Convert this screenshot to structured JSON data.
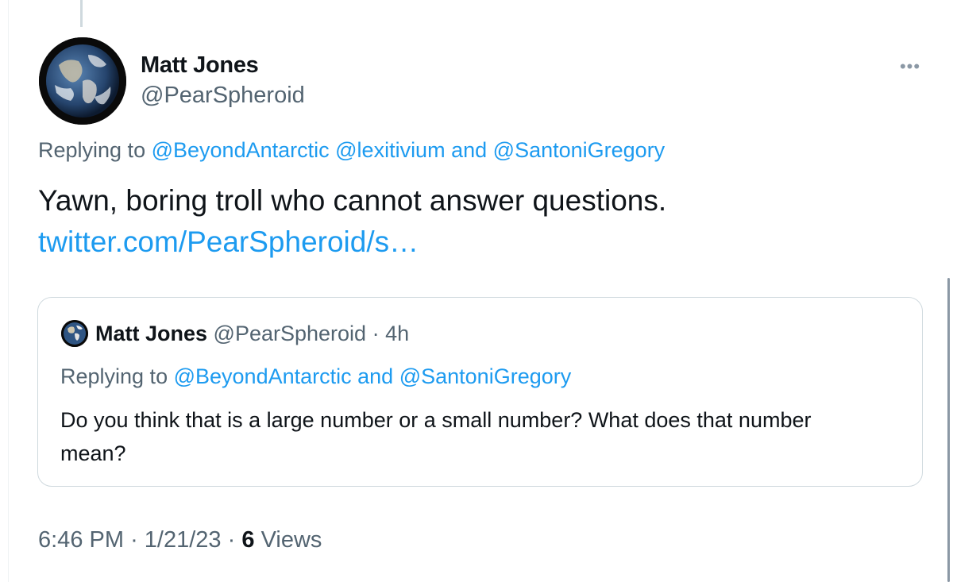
{
  "tweet": {
    "author": {
      "name": "Matt Jones",
      "handle": "@PearSpheroid"
    },
    "replying_to": {
      "prefix": "Replying to",
      "mentions": [
        "@BeyondAntarctic",
        "@lexitivium"
      ],
      "conjunction": "and",
      "last_mention": "@SantoniGregory"
    },
    "text": "Yawn, boring troll who cannot answer questions.",
    "link": "twitter.com/PearSpheroid/s…",
    "more_icon": "more-horizontal-icon"
  },
  "quote": {
    "author_name": "Matt Jones",
    "author_handle": "@PearSpheroid",
    "separator": "·",
    "time": "4h",
    "replying_to": {
      "prefix": "Replying to",
      "mention": "@BeyondAntarctic",
      "conjunction": "and",
      "last_mention": "@SantoniGregory"
    },
    "text": "Do you think that is a large number or a small number? What does that number mean?"
  },
  "footer": {
    "time": "6:46 PM",
    "separator": "·",
    "date": "1/21/23",
    "views_count": "6",
    "views_label": "Views"
  },
  "colors": {
    "link": "#1d9bf0",
    "secondary_text": "#536471",
    "primary_text": "#0f1419",
    "border": "#cfd9de"
  }
}
